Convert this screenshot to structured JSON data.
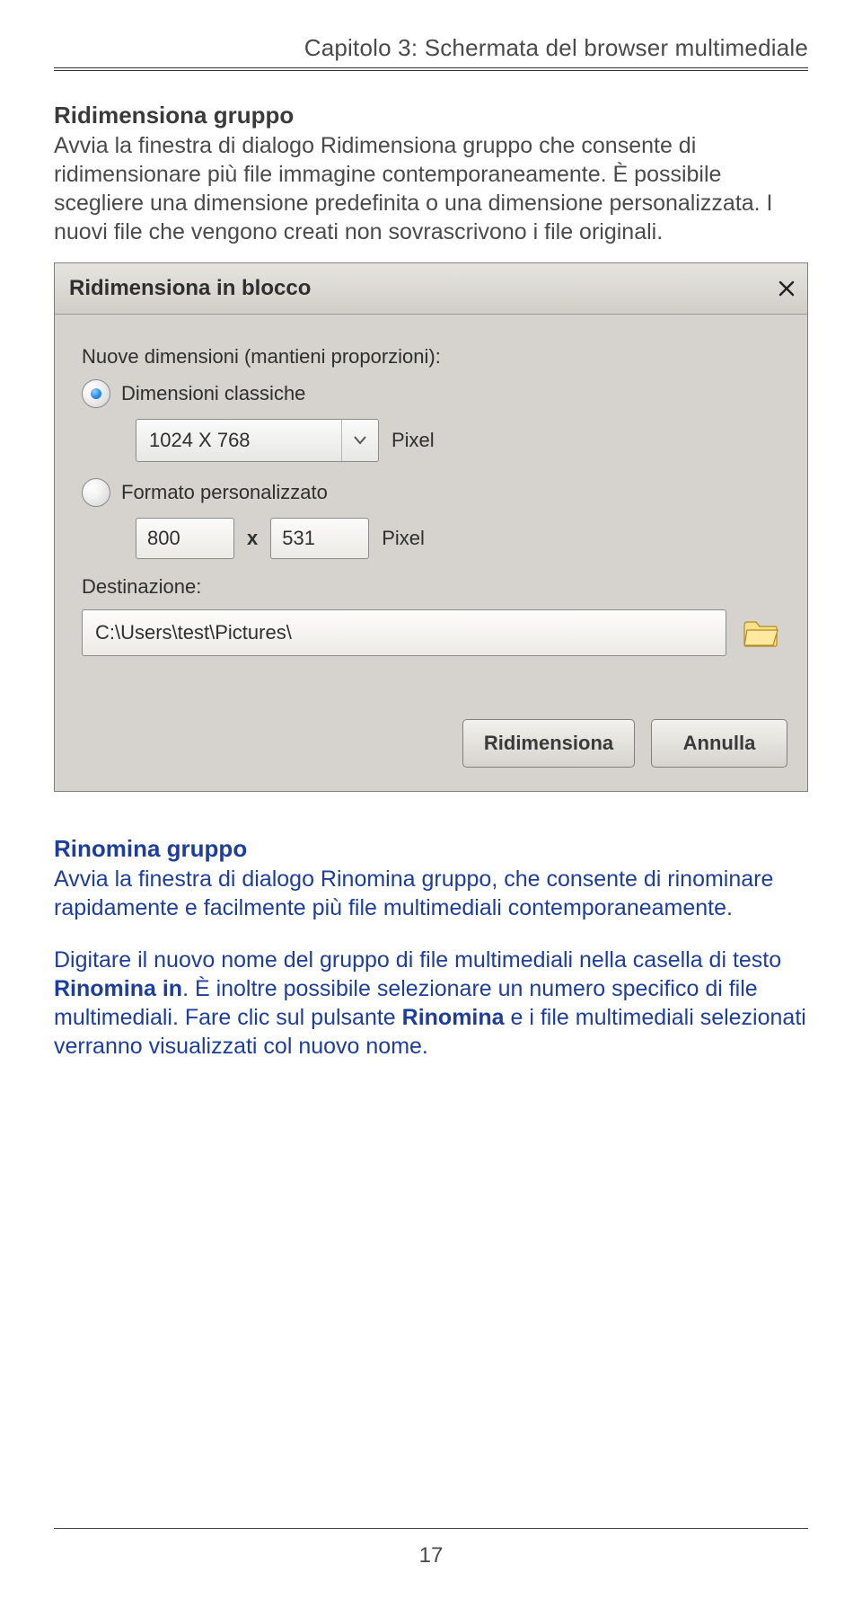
{
  "chapter": {
    "header": "Capitolo 3: Schermata del browser multimediale"
  },
  "section1": {
    "title": "Ridimensiona gruppo",
    "p1": "Avvia la finestra di dialogo Ridimensiona gruppo che consente di ridimensionare più file immagine contemporaneamente. È possibile scegliere una dimensione predefinita o una dimensione personalizzata. I nuovi file che vengono creati non sovrascrivono i file originali."
  },
  "dialog": {
    "title": "Ridimensiona in blocco",
    "caption": "Nuove dimensioni (mantieni proporzioni):",
    "optClassic": "Dimensioni classiche",
    "preset": "1024 X 768",
    "unitPixel": "Pixel",
    "optCustom": "Formato personalizzato",
    "customW": "800",
    "times": "x",
    "customH": "531",
    "destLabel": "Destinazione:",
    "destValue": "C:\\Users\\test\\Pictures\\",
    "btnResize": "Ridimensiona",
    "btnCancel": "Annulla"
  },
  "section2": {
    "title": "Rinomina gruppo",
    "p1": "Avvia la finestra di dialogo Rinomina gruppo, che consente di rinominare rapidamente e facilmente più file multimediali contemporaneamente.",
    "p2a": "Digitare il nuovo nome del gruppo di file multimediali nella casella di testo ",
    "p2bold1": "Rinomina in",
    "p2b": ". È inoltre possibile selezionare un numero specifico di file multimediali. Fare clic sul pulsante ",
    "p2bold2": "Rinomina",
    "p2c": " e i file multimediali selezionati verranno visualizzati col nuovo nome."
  },
  "pageNumber": "17"
}
